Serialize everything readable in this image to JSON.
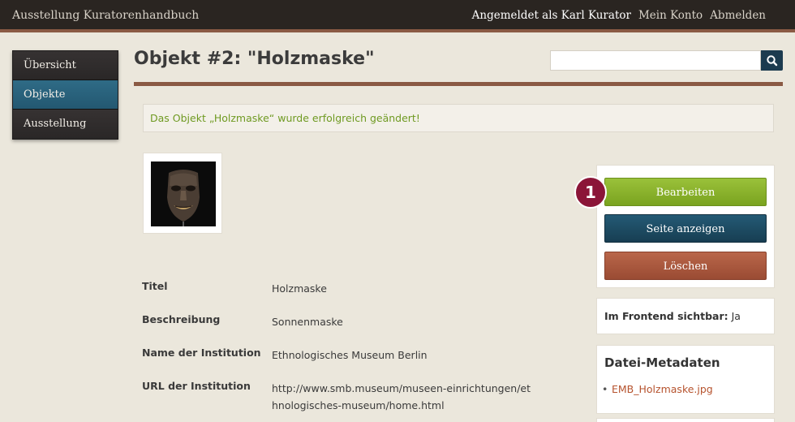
{
  "topbar": {
    "brand": "Ausstellung Kuratorenhandbuch",
    "logged_in": "Angemeldet als Karl Kurator",
    "account": "Mein Konto",
    "logout": "Abmelden"
  },
  "sidenav": {
    "items": [
      {
        "label": "Übersicht",
        "active": false
      },
      {
        "label": "Objekte",
        "active": true
      },
      {
        "label": "Ausstellung",
        "active": false
      }
    ]
  },
  "page": {
    "title": "Objekt #2: \"Holzmaske\""
  },
  "search": {
    "value": "",
    "placeholder": ""
  },
  "flash": {
    "message": "Das Objekt „Holzmaske“ wurde erfolgreich geändert!"
  },
  "details": [
    {
      "key": "Titel",
      "value": "Holzmaske"
    },
    {
      "key": "Beschreibung",
      "value": "Sonnenmaske"
    },
    {
      "key": "Name der Institution",
      "value": "Ethnologisches Museum Berlin"
    },
    {
      "key": "URL der Institution",
      "value": "http://www.smb.museum/museen-einrichtungen/ethnologisches-museum/home.html"
    }
  ],
  "actions": {
    "edit": "Bearbeiten",
    "view": "Seite anzeigen",
    "delete": "Löschen",
    "badge": "1"
  },
  "visibility": {
    "label": "Im Frontend sichtbar:",
    "value": "Ja"
  },
  "metadata": {
    "heading": "Datei-Metadaten",
    "file": "EMB_Holzmaske.jpg"
  },
  "colors": {
    "accent": "#8a5a44",
    "nav_active": "#2f6b86",
    "edit": "#8fb82e",
    "view": "#1c4760",
    "delete": "#a8553b",
    "badge": "#8b1538",
    "success_text": "#6f9a22",
    "link": "#b6532e"
  }
}
